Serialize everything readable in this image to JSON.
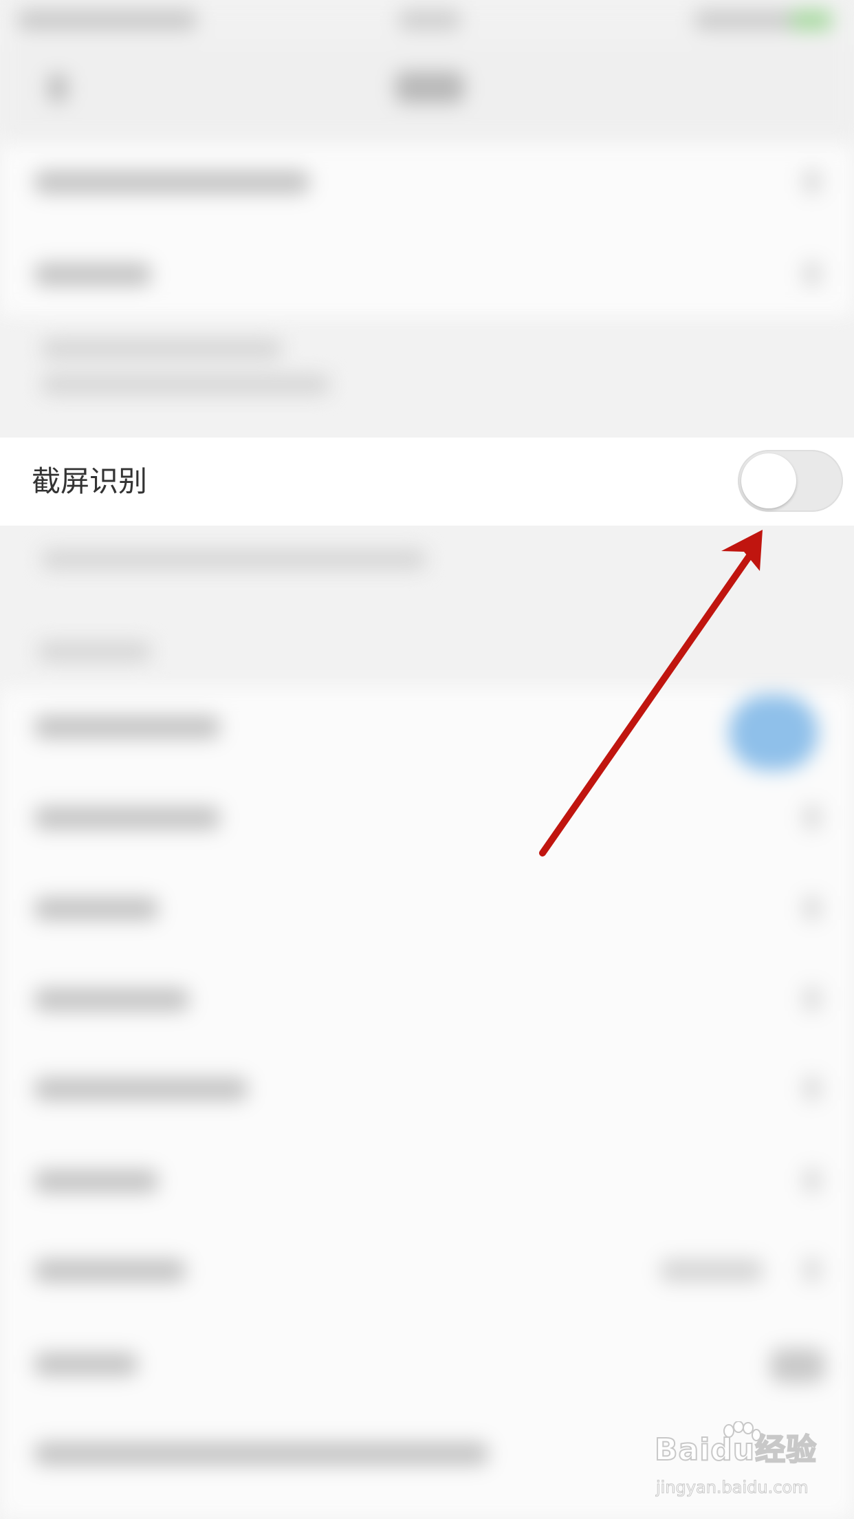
{
  "screen_recognition_row": {
    "label": "截屏识别",
    "toggle_state": "off"
  },
  "watermark": {
    "logo_text": "Baidu经验",
    "url_text": "jingyan.baidu.com"
  },
  "colors": {
    "annotation_arrow": "#c0150f",
    "toggle_off_track": "#e9e9e9",
    "blurred_accent": "#8fc0ea"
  }
}
